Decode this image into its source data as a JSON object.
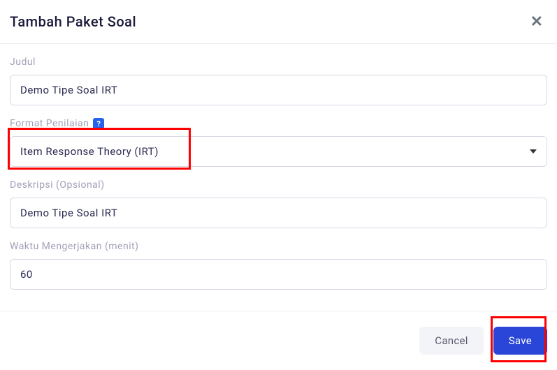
{
  "modal": {
    "title": "Tambah Paket Soal"
  },
  "fields": {
    "judul": {
      "label": "Judul",
      "value": "Demo Tipe Soal IRT"
    },
    "format": {
      "label": "Format Penilaian",
      "help": "?",
      "value": "Item Response Theory (IRT)"
    },
    "deskripsi": {
      "label": "Deskripsi (Opsional)",
      "value": "Demo Tipe Soal IRT"
    },
    "waktu": {
      "label": "Waktu Mengerjakan (menit)",
      "value": "60"
    }
  },
  "footer": {
    "cancel": "Cancel",
    "save": "Save"
  }
}
